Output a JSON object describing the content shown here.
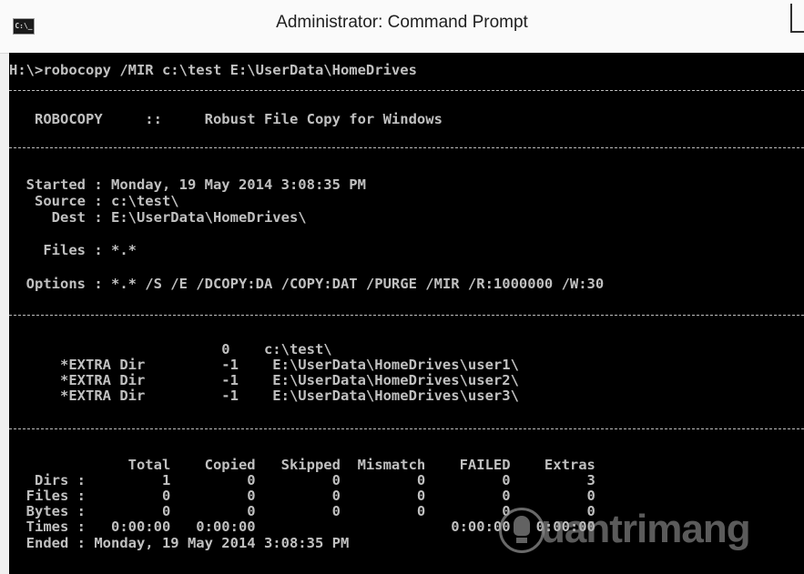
{
  "window": {
    "title": "Administrator: Command Prompt",
    "icon_text": "C:\\_"
  },
  "console": {
    "command_line": "H:\\>robocopy /MIR c:\\test E:\\UserData\\HomeDrives",
    "header_line": "   ROBOCOPY     ::     Robust File Copy for Windows",
    "started_line": "  Started : Monday, 19 May 2014 3:08:35 PM",
    "source_line": "   Source : c:\\test\\",
    "dest_line": "     Dest : E:\\UserData\\HomeDrives\\",
    "files_line": "    Files : *.*",
    "options_line": "  Options : *.* /S /E /DCOPY:DA /COPY:DAT /PURGE /MIR /R:1000000 /W:30",
    "dir_lines": [
      "                         0    c:\\test\\",
      "      *EXTRA Dir         -1    E:\\UserData\\HomeDrives\\user1\\",
      "      *EXTRA Dir         -1    E:\\UserData\\HomeDrives\\user2\\",
      "      *EXTRA Dir         -1    E:\\UserData\\HomeDrives\\user3\\"
    ],
    "summary_lines": [
      "              Total    Copied   Skipped  Mismatch    FAILED    Extras",
      "   Dirs :         1         0         0         0         0         3",
      "  Files :         0         0         0         0         0         0",
      "  Bytes :         0         0         0         0         0         0",
      "  Times :   0:00:00   0:00:00                       0:00:00   0:00:00",
      "  Ended : Monday, 19 May 2014 3:08:35 PM"
    ]
  },
  "watermark": {
    "text": "uantrimang",
    "icon": "lightbulb-icon"
  }
}
